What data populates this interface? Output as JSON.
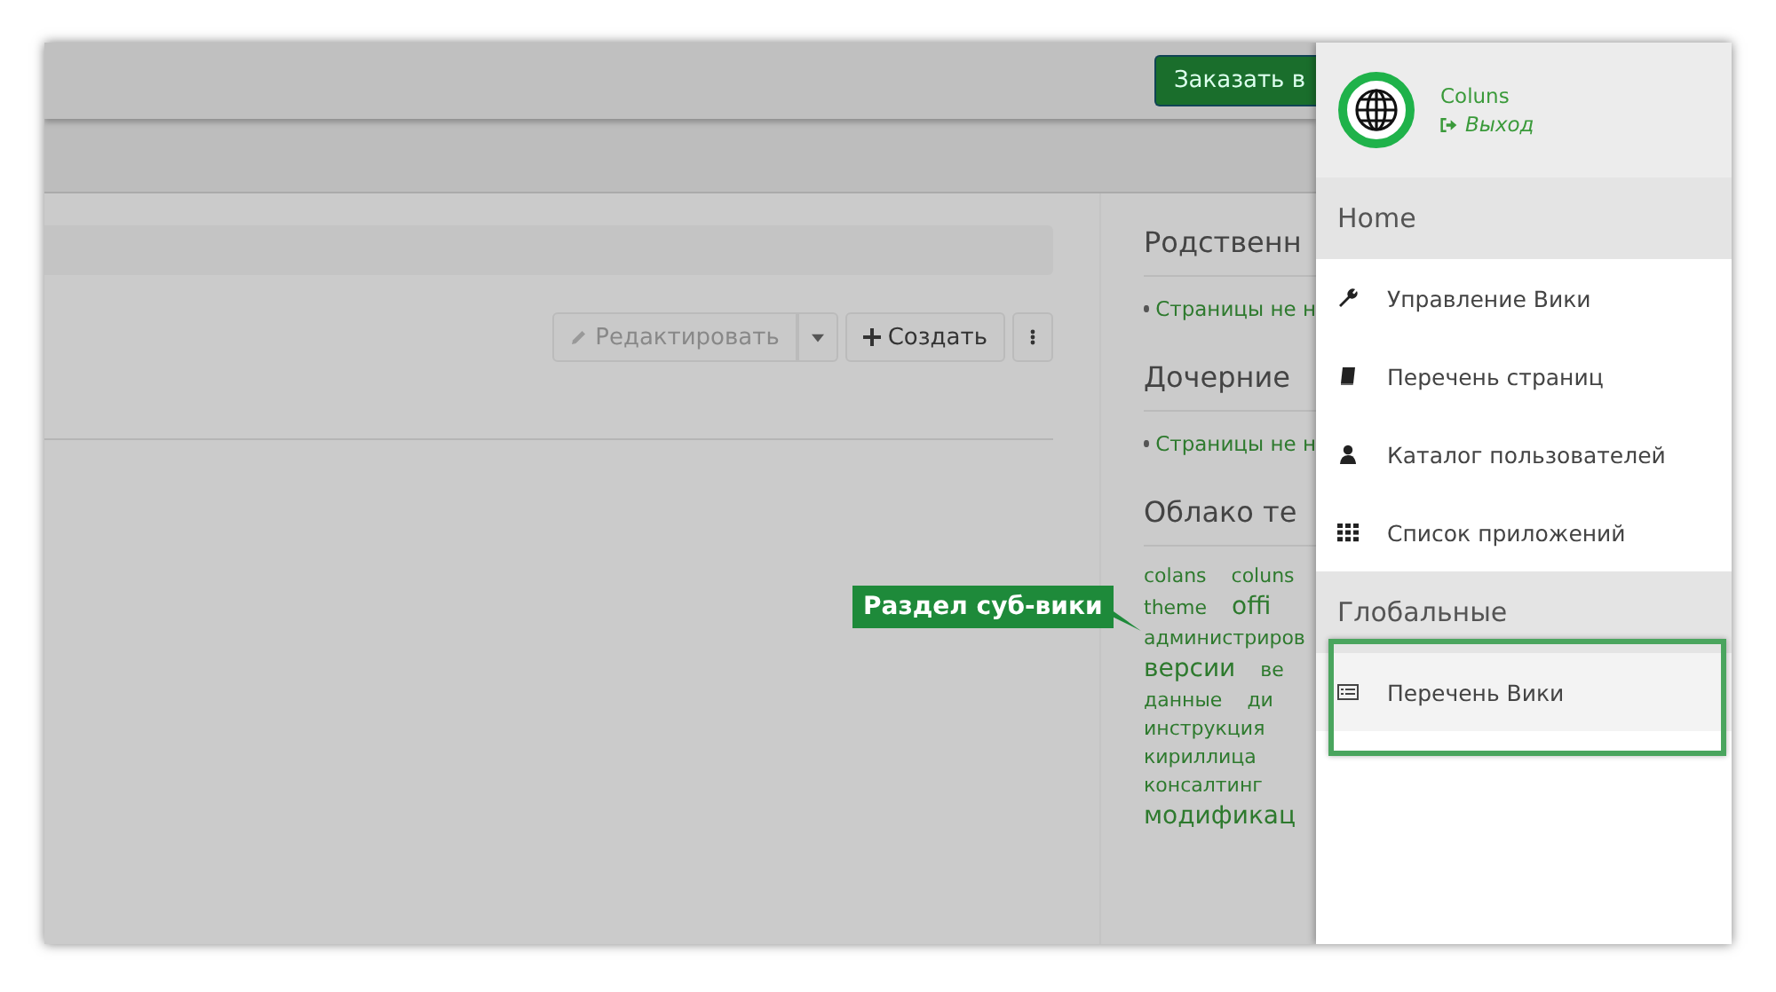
{
  "header": {
    "order_button": "Заказать в"
  },
  "toolbar": {
    "edit_button": "Редактировать",
    "create_button": "Создать"
  },
  "side_sections": [
    {
      "title": "Родственн",
      "links": [
        "Страницы не н"
      ]
    },
    {
      "title": "Дочерние",
      "links": [
        "Страницы не н"
      ]
    }
  ],
  "tag_cloud": {
    "title": "Облако те",
    "tags": [
      {
        "label": "colans",
        "kind": "small"
      },
      {
        "label": "coluns",
        "kind": "small"
      },
      {
        "label": "theme",
        "kind": "small"
      },
      {
        "label": "offi",
        "kind": "large"
      },
      {
        "label": "администриров",
        "kind": "small"
      },
      {
        "label": "версии",
        "kind": "large"
      },
      {
        "label": "ве",
        "kind": "small"
      },
      {
        "label": "данные",
        "kind": "small"
      },
      {
        "label": "ди",
        "kind": "small"
      },
      {
        "label": "инструкция",
        "kind": "small"
      },
      {
        "label": "кириллица",
        "kind": "small"
      },
      {
        "label": "консалтинг",
        "kind": "small"
      },
      {
        "label": "модификац",
        "kind": "large"
      }
    ]
  },
  "drawer": {
    "user": {
      "name": "Coluns",
      "logout": "Выход"
    },
    "sections": [
      {
        "title": "Home",
        "items": [
          {
            "label": "Управление Вики",
            "selected": false
          },
          {
            "label": "Перечень страниц",
            "selected": false
          },
          {
            "label": "Каталог пользователей",
            "selected": false
          },
          {
            "label": "Список приложений",
            "selected": false
          }
        ]
      },
      {
        "title": "Глобальные",
        "items": [
          {
            "label": "Перечень Вики",
            "selected": true
          }
        ]
      }
    ]
  },
  "callout": {
    "label": "Раздел суб-вики"
  }
}
